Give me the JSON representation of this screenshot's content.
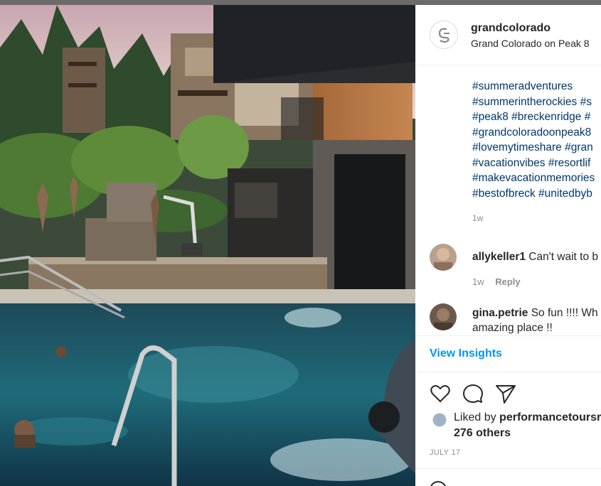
{
  "post": {
    "username": "grandcolorado",
    "location": "Grand Colorado on Peak 8",
    "caption_lines": [
      "#summeradventures",
      "#summerintherockies #s",
      "#peak8 #breckenridge #",
      "#grandcoloradoonpeak8",
      "#lovemytimeshare #gran",
      "#vacationvibes #resortlif",
      "#makevacationmemories",
      "#bestofbreck #unitedbyb"
    ],
    "caption_time": "1w"
  },
  "comments": [
    {
      "username": "allykeller1",
      "text": "Can't wait to b",
      "time": "1w",
      "reply_label": "Reply"
    },
    {
      "username": "gina.petrie",
      "text": "So fun !!!! Wh",
      "text_line2": "amazing place !!"
    }
  ],
  "insights": {
    "label": "View Insights"
  },
  "actions": {
    "like_icon": "heart-icon",
    "comment_icon": "comment-bubble-icon",
    "share_icon": "paper-plane-icon"
  },
  "likes": {
    "prefix": "Liked by",
    "user": "performancetoursr",
    "others": "276 others"
  },
  "date": "JULY 17",
  "colors": {
    "link": "#00376b",
    "insights": "#0095f6",
    "muted": "#8e8e8e"
  }
}
